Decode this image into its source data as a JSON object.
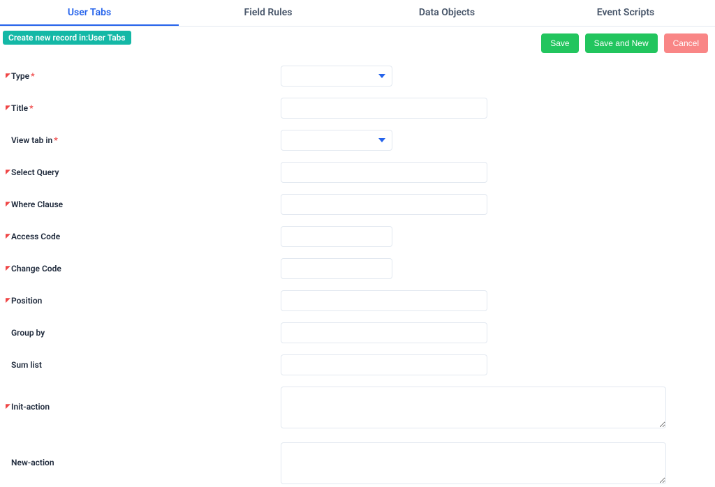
{
  "tabs": [
    {
      "label": "User Tabs",
      "active": true
    },
    {
      "label": "Field Rules",
      "active": false
    },
    {
      "label": "Data Objects",
      "active": false
    },
    {
      "label": "Event Scripts",
      "active": false
    }
  ],
  "breadcrumb": "Create new record in:User Tabs",
  "actions": {
    "save": "Save",
    "save_and_new": "Save and New",
    "cancel": "Cancel"
  },
  "fields": {
    "type": {
      "label": "Type",
      "tick": true,
      "required": true
    },
    "title": {
      "label": "Title",
      "tick": true,
      "required": true
    },
    "view_tab_in": {
      "label": "View tab in",
      "tick": false,
      "required": true
    },
    "select_query": {
      "label": "Select Query",
      "tick": true,
      "required": false
    },
    "where_clause": {
      "label": "Where Clause",
      "tick": true,
      "required": false
    },
    "access_code": {
      "label": "Access Code",
      "tick": true,
      "required": false
    },
    "change_code": {
      "label": "Change Code",
      "tick": true,
      "required": false
    },
    "position": {
      "label": "Position",
      "tick": true,
      "required": false
    },
    "group_by": {
      "label": "Group by",
      "tick": false,
      "required": false
    },
    "sum_list": {
      "label": "Sum list",
      "tick": false,
      "required": false
    },
    "init_action": {
      "label": "Init-action",
      "tick": true,
      "required": false
    },
    "new_action": {
      "label": "New-action",
      "tick": false,
      "required": false
    }
  }
}
